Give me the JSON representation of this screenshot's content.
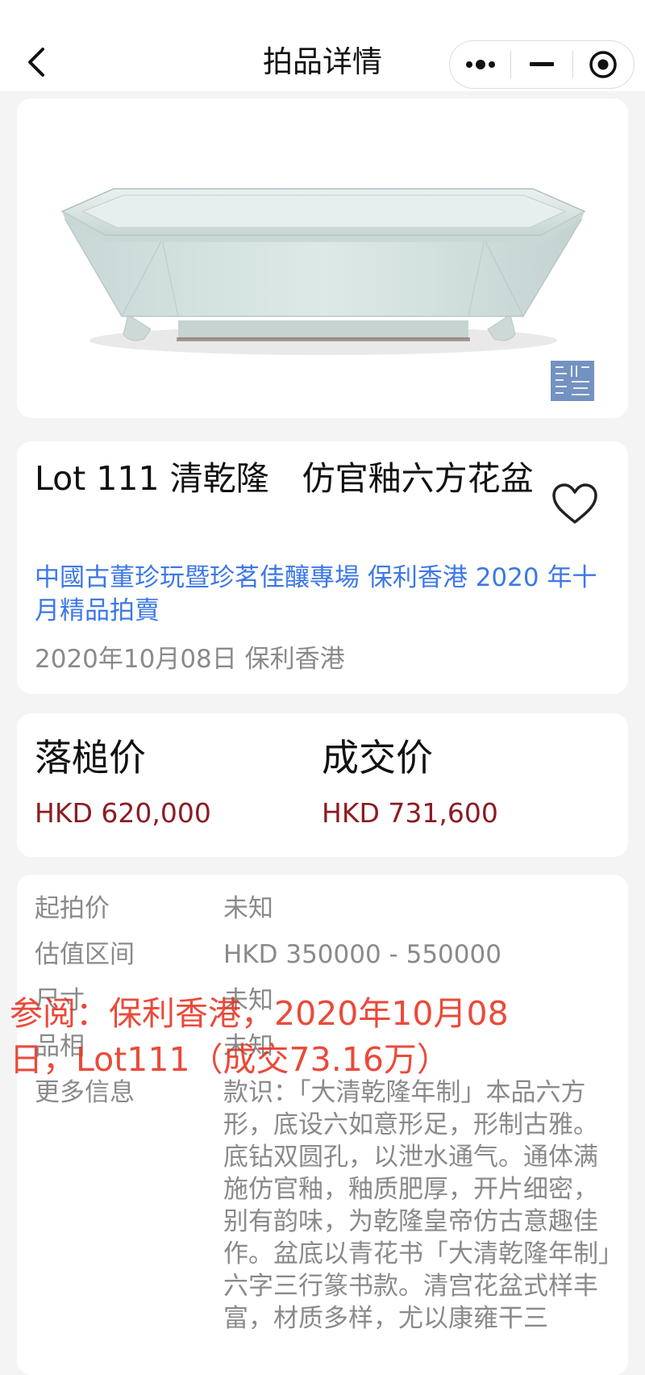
{
  "nav": {
    "title": "拍品详情"
  },
  "lot": {
    "title": "Lot 111 清乾隆　仿官釉六方花盆",
    "sale_name": "中國古董珍玩暨珍茗佳釀專場 保利香港 2020 年十月精品拍賣",
    "date_house": "2020年10月08日 保利香港"
  },
  "prices": {
    "hammer_label": "落槌价",
    "hammer_value": "HKD 620,000",
    "final_label": "成交价",
    "final_value": "HKD 731,600"
  },
  "info": {
    "start_label": "起拍价",
    "start_value": "未知",
    "estimate_label": "估值区间",
    "estimate_value": "HKD 350000 - 550000",
    "size_label": "尺寸",
    "size_value": "未知",
    "condition_label": "品相",
    "condition_value": "未知",
    "more_label": "更多信息",
    "more_value": "款识：「大清乾隆年制」本品六方形，底设六如意形足，形制古雅。底钻双圆孔，以泄水通气。通体满施仿官釉，釉质肥厚，开片细密，别有韵味，为乾隆皇帝仿古意趣佳作。盆底以青花书「大清乾隆年制」六字三行篆书款。清宫花盆式样丰富，材质多样，尤以康雍干三"
  },
  "overlay": {
    "text": "参阅：保利香港，2020年10月08日，Lot111（成交73.16万）"
  },
  "colors": {
    "link": "#3d78e8",
    "price": "#8b1c22",
    "overlay": "#e8321f",
    "glaze": "#d5e2e0"
  },
  "icons": [
    "back-arrow-icon",
    "more-dots-icon",
    "minimize-icon",
    "close-target-icon",
    "heart-icon"
  ]
}
